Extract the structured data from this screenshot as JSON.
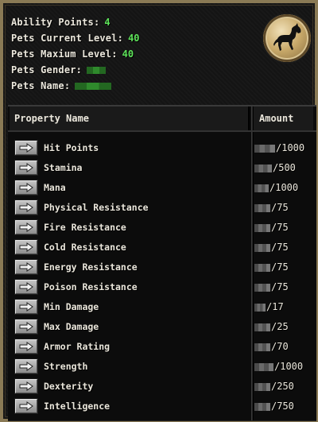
{
  "info": {
    "ability_points_label": "Ability Points:",
    "ability_points_value": "4",
    "current_level_label": "Pets Current Level:",
    "current_level_value": "40",
    "maximum_level_label": "Pets Maxium Level:",
    "maximum_level_value": "40",
    "gender_label": "Pets Gender:",
    "name_label": "Pets Name:"
  },
  "emblem_icon": "horse-icon",
  "table": {
    "header_property": "Property Name",
    "header_amount": "Amount",
    "rows": [
      {
        "name": "Hit Points",
        "max": "/1000"
      },
      {
        "name": "Stamina",
        "max": "/500"
      },
      {
        "name": "Mana",
        "max": "/1000"
      },
      {
        "name": "Physical Resistance",
        "max": "/75"
      },
      {
        "name": "Fire Resistance",
        "max": "/75"
      },
      {
        "name": "Cold Resistance",
        "max": "/75"
      },
      {
        "name": "Energy Resistance",
        "max": "/75"
      },
      {
        "name": "Poison Resistance",
        "max": "/75"
      },
      {
        "name": "Min Damage",
        "max": "/17"
      },
      {
        "name": "Max Damage",
        "max": "/25"
      },
      {
        "name": "Armor Rating",
        "max": "/70"
      },
      {
        "name": "Strength",
        "max": "/1000"
      },
      {
        "name": "Dexterity",
        "max": "/250"
      },
      {
        "name": "Intelligence",
        "max": "/750"
      }
    ]
  },
  "colors": {
    "frame_gold": "#8a7a55",
    "value_green": "#5ee35a",
    "text": "#ebe7dc"
  }
}
